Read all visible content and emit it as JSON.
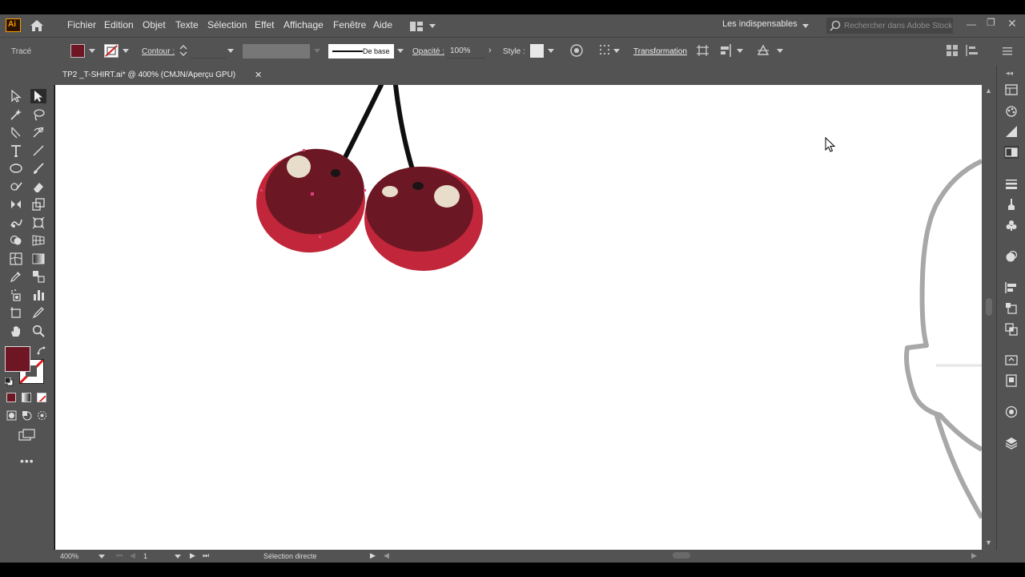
{
  "app": {
    "logo": "Ai",
    "home_icon": "home-icon"
  },
  "menu": [
    "Fichier",
    "Edition",
    "Objet",
    "Texte",
    "Sélection",
    "Effet",
    "Affichage",
    "Fenêtre",
    "Aide"
  ],
  "workspace": {
    "label": "Les indispensables"
  },
  "search": {
    "placeholder": "Rechercher dans Adobe Stock"
  },
  "control": {
    "selection_type": "Tracé",
    "fill_color": "#6e1624",
    "contour_label": "Contour :",
    "stroke_profile": "De base",
    "opacity_label": "Opacité :",
    "opacity_value": "100%",
    "style_label": "Style :",
    "transform_label": "Transformation"
  },
  "document": {
    "tab_title": "TP2 _T-SHIRT.ai* @ 400% (CMJN/Aperçu GPU)"
  },
  "status": {
    "zoom": "400%",
    "artboard": "1",
    "tool_name": "Sélection directe"
  },
  "tools": [
    "selection-tool-icon",
    "direct-selection-tool-icon",
    "magic-wand-icon",
    "lasso-icon",
    "pen-icon",
    "curvature-icon",
    "type-icon",
    "line-icon",
    "ellipse-icon",
    "paintbrush-icon",
    "shaper-icon",
    "eraser-icon",
    "rotate-icon",
    "scale-icon",
    "warp-icon",
    "free-transform-icon",
    "shape-builder-icon",
    "perspective-icon",
    "mesh-icon",
    "gradient-icon",
    "eyedropper-icon",
    "blend-icon",
    "symbol-sprayer-icon",
    "column-graph-icon",
    "artboard-icon",
    "slice-icon",
    "hand-icon",
    "zoom-icon"
  ],
  "right_panel_icons": [
    "libraries-icon",
    "color-guide-icon",
    "gradient-panel-icon",
    "transparency-icon",
    "stroke-panel-icon",
    "brushes-icon",
    "symbols-icon",
    "appearance-icon",
    "align-icon",
    "transform-panel-icon",
    "pathfinder-icon",
    "asset-export-icon",
    "artboards-panel-icon",
    "color-panel-icon",
    "layers-icon"
  ],
  "colors": {
    "ui_bg": "#535353",
    "cherry_dark": "#6b1824",
    "cherry_red": "#c2263a",
    "highlight": "#e8dccb",
    "selection_point": "#e0407a"
  }
}
